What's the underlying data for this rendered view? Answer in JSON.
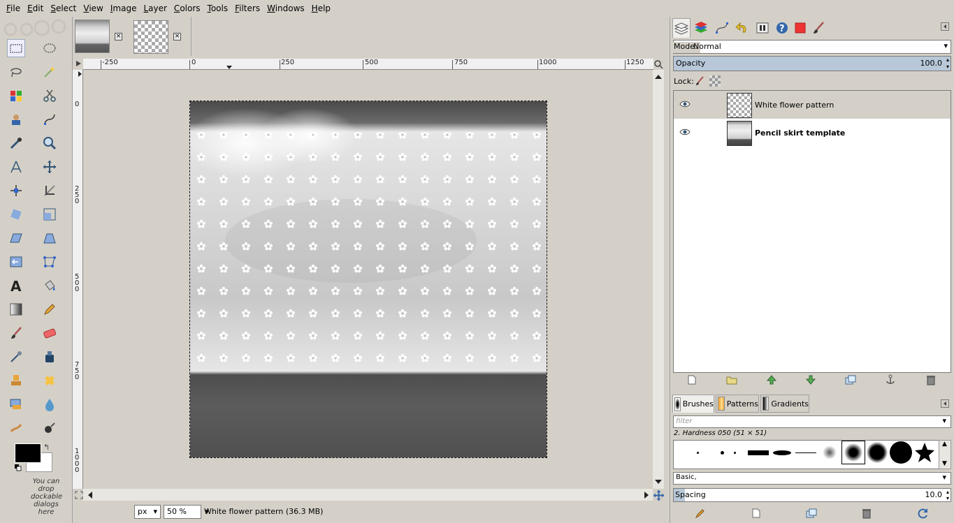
{
  "menu": [
    "File",
    "Edit",
    "Select",
    "View",
    "Image",
    "Layer",
    "Colors",
    "Tools",
    "Filters",
    "Windows",
    "Help"
  ],
  "toolbox": {
    "drop_note": "You can drop dockable dialogs here",
    "swap_icon": "swap-colors-icon"
  },
  "image_tabs": [
    {
      "name": "pencil-skirt-thumb"
    },
    {
      "name": "flower-pattern-thumb"
    }
  ],
  "ruler": {
    "h_labels": [
      "-250",
      "0",
      "250",
      "500",
      "750",
      "1000",
      "1250"
    ],
    "v_labels": [
      "0",
      "250",
      "500",
      "750",
      "1000"
    ]
  },
  "status": {
    "unit": "px",
    "zoom": "50 %",
    "text": "White flower pattern (36.3 MB)"
  },
  "layers_panel": {
    "mode_label": "Mode:",
    "mode_value": "Normal",
    "opacity_label": "Opacity",
    "opacity_value": "100.0",
    "lock_label": "Lock:",
    "layers": [
      {
        "name": "White flower pattern",
        "visible": true,
        "selected": true,
        "bold": false
      },
      {
        "name": "Pencil skirt template",
        "visible": true,
        "selected": false,
        "bold": true
      }
    ]
  },
  "brushes_panel": {
    "tabs": [
      "Brushes",
      "Patterns",
      "Gradients"
    ],
    "filter_placeholder": "filter",
    "brush_name": "2. Hardness 050 (51 × 51)",
    "preset": "Basic,",
    "spacing_label": "Spacing",
    "spacing_value": "10.0"
  },
  "colors": {
    "fg": "#000000",
    "bg": "#ffffff",
    "selection": "#ffffff",
    "accent": "#b8c8d8"
  }
}
